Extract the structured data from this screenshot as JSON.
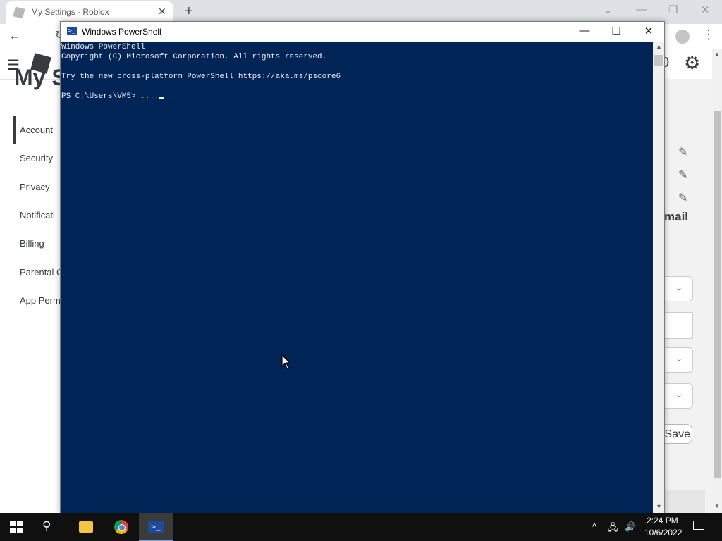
{
  "browser": {
    "tab_title": "My Settings - Roblox",
    "tab_close": "✕",
    "new_tab": "+",
    "win_min": "—",
    "win_restore": "❐",
    "win_close": "✕",
    "win_chevron": "⌄",
    "back_icon": "←",
    "reload_icon": "↻",
    "menu_icon": "⋮"
  },
  "roblox": {
    "hamburger": "☰",
    "robux_text": "0",
    "gear": "⚙",
    "page_title": "My S",
    "nav_items": [
      "Account",
      "Security",
      "Privacy",
      "Notificati",
      "Billing",
      "Parental C",
      "App Perm"
    ],
    "edit_icon": "✎",
    "email_label": "mail",
    "chevron": "⌄",
    "save_label": "Save"
  },
  "scrollbar": {
    "up": "▲",
    "down": "▼"
  },
  "powershell": {
    "title": "Windows PowerShell",
    "icon_glyph": ">_",
    "min": "—",
    "max": "☐",
    "close": "✕",
    "lines": [
      "Windows PowerShell",
      "Copyright (C) Microsoft Corporation. All rights reserved.",
      "",
      "Try the new cross-platform PowerShell https://aka.ms/pscore6",
      ""
    ],
    "prompt": "PS C:\\Users\\VM5> ",
    "input": "...."
  },
  "taskbar": {
    "search_icon": "⚲",
    "ps_glyph": ">_",
    "tray_chevron": "^",
    "tray_network": "🖧",
    "tray_volume": "🔊",
    "time": "2:24 PM",
    "date": "10/6/2022"
  }
}
